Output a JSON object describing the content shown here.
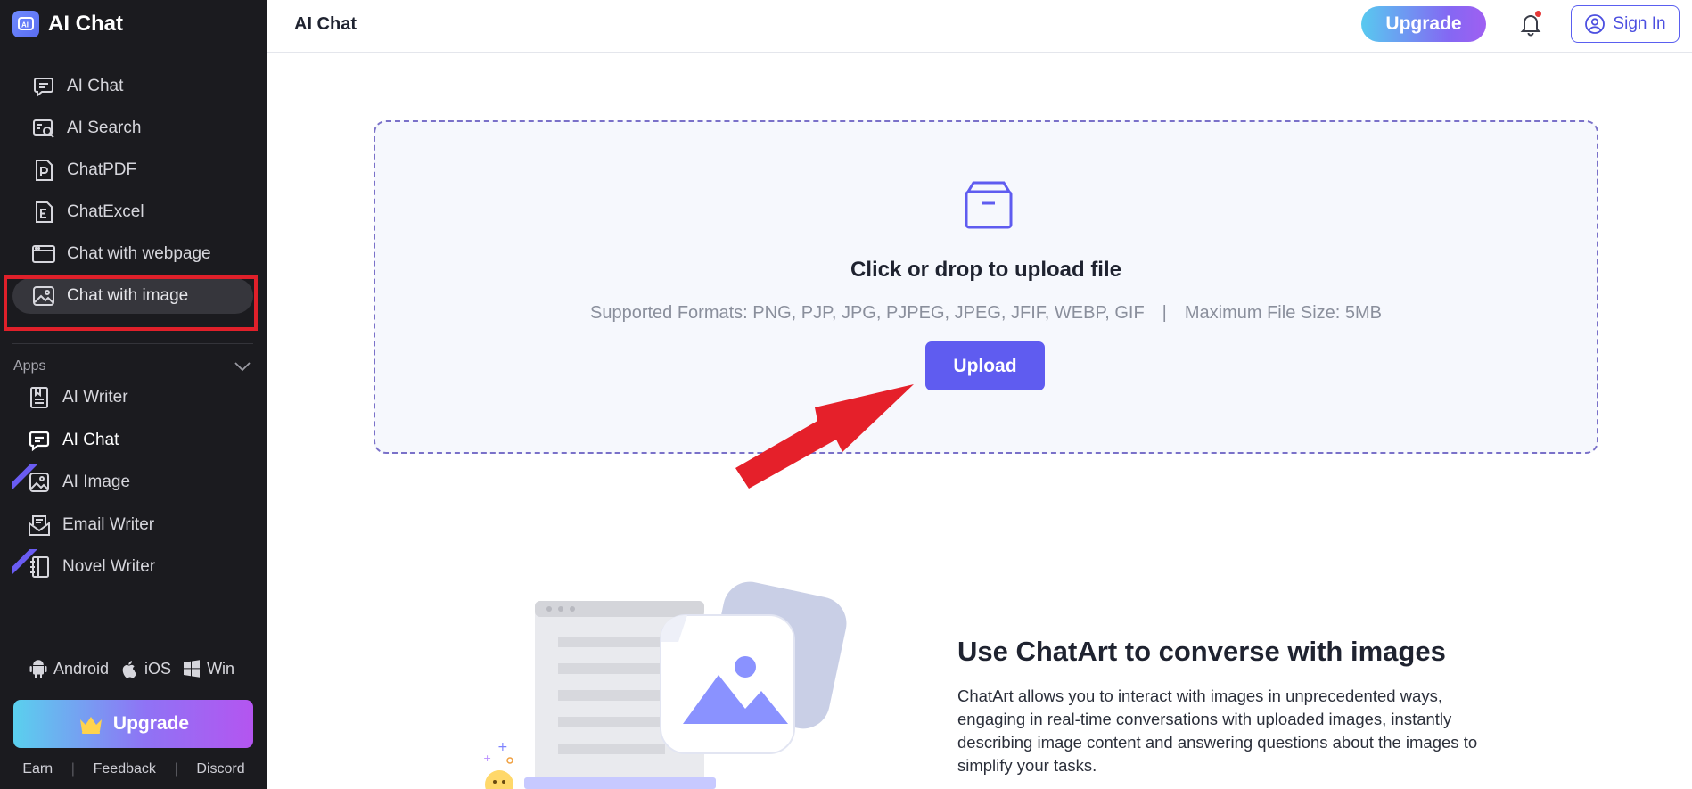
{
  "brand": {
    "title": "AI Chat"
  },
  "sidebar": {
    "nav": [
      {
        "label": "AI Chat",
        "icon": "chat-bubble-icon"
      },
      {
        "label": "AI Search",
        "icon": "search-window-icon"
      },
      {
        "label": "ChatPDF",
        "icon": "pdf-file-icon"
      },
      {
        "label": "ChatExcel",
        "icon": "excel-file-icon"
      },
      {
        "label": "Chat with webpage",
        "icon": "webpage-icon"
      },
      {
        "label": "Chat with image",
        "icon": "image-icon",
        "active": true
      }
    ],
    "apps_label": "Apps",
    "apps": [
      {
        "label": "AI Writer",
        "icon": "document-icon"
      },
      {
        "label": "AI Chat",
        "icon": "chat-bubble-icon"
      },
      {
        "label": "AI Image",
        "icon": "image-icon",
        "badge": "new"
      },
      {
        "label": "Email Writer",
        "icon": "email-icon"
      },
      {
        "label": "Novel Writer",
        "icon": "notebook-icon",
        "badge": "new"
      }
    ],
    "platforms": {
      "android": "Android",
      "ios": "iOS",
      "win": "Win"
    },
    "upgrade_label": "Upgrade",
    "footer": {
      "earn": "Earn",
      "feedback": "Feedback",
      "discord": "Discord"
    }
  },
  "header": {
    "title": "AI Chat",
    "upgrade_label": "Upgrade",
    "signin_label": "Sign In"
  },
  "upload": {
    "title": "Click or drop to upload file",
    "formats": "Supported Formats: PNG, PJP, JPG, PJPEG, JPEG, JFIF, WEBP, GIF",
    "separator": "|",
    "max_size": "Maximum File Size: 5MB",
    "button_label": "Upload"
  },
  "promo": {
    "title": "Use ChatArt to converse with images",
    "text": "ChatArt allows you to interact with images in unprecedented ways, engaging in real-time conversations with uploaded images, instantly describing image content and answering questions about the images to simplify your tasks."
  },
  "colors": {
    "sidebar_bg": "#1b1b1f",
    "accent": "#5f5cf0",
    "highlight": "#e0202a",
    "arrow": "#e5202a"
  }
}
